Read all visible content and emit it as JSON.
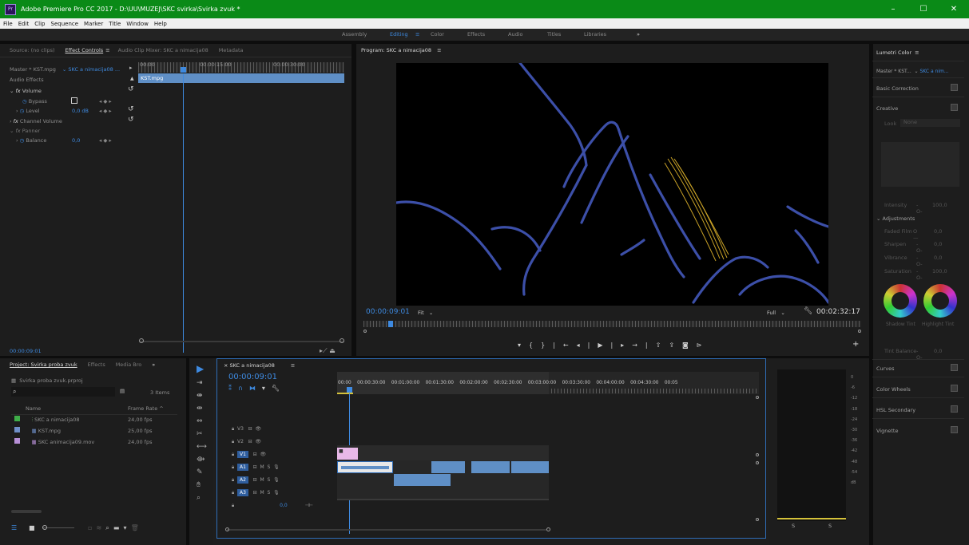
{
  "window": {
    "title": "Adobe Premiere Pro CC 2017 - D:\\UU\\MUZEJ\\SKC svirka\\Svirka zvuk *",
    "app_icon": "Pr",
    "minimize": "–",
    "maximize": "☐",
    "close": "✕"
  },
  "menu": [
    "File",
    "Edit",
    "Clip",
    "Sequence",
    "Marker",
    "Title",
    "Window",
    "Help"
  ],
  "workspaces": {
    "items": [
      "Assembly",
      "Editing",
      "Color",
      "Effects",
      "Audio",
      "Titles",
      "Libraries"
    ],
    "active": "Editing",
    "more": "»",
    "active_menu": "≡"
  },
  "source_panel": {
    "tabs": [
      "Source: (no clips)",
      "Effect Controls",
      "Audio Clip Mixer: SKC a nimacija08",
      "Metadata"
    ],
    "tab_menu": "≡",
    "master_label": "Master * KST.mpg",
    "sequence_label": "SKC a nimacija08 ...",
    "ruler_times": [
      "00:00",
      "00:00:15:00",
      "00:00:30:00"
    ],
    "clip_name": "KST.mpg",
    "audio_effects": "Audio Effects",
    "fx_volume": "Volume",
    "bypass": "Bypass",
    "level": "Level",
    "level_value": "0,0 dB",
    "fx_channel_volume": "Channel Volume",
    "panner": "Panner",
    "balance": "Balance",
    "balance_value": "0,0",
    "bottom_time": "00:00:09:01"
  },
  "program": {
    "title": "Program: SKC a nimacija08",
    "title_menu": "≡",
    "timecode": "00:00:09:01",
    "fit": "Fit",
    "full": "Full",
    "duration": "00:02:32:17"
  },
  "project": {
    "tabs": [
      "Project: Svirka proba zvuk",
      "Effects",
      "Media Bro"
    ],
    "more": "»",
    "file": "Svirka proba zvuk.prproj",
    "items_count": "3 Items",
    "col_name": "Name",
    "col_rate": "Frame Rate",
    "items": [
      {
        "name": "SKC a nimacija08",
        "rate": "24,00 fps",
        "color": "#3fae49"
      },
      {
        "name": "KST.mpg",
        "rate": "25,00 fps",
        "color": "#6f8fc8"
      },
      {
        "name": "SKC animacija09.mov",
        "rate": "24,00 fps",
        "color": "#b78fd6"
      }
    ]
  },
  "timeline": {
    "tab": "SKC a nimacija08",
    "tab_menu": "≡",
    "timecode": "00:00:09:01",
    "ruler": [
      "00:00",
      "00:00:30:00",
      "00:01:00:00",
      "00:01:30:00",
      "00:02:00:00",
      "00:02:30:00",
      "00:03:00:00",
      "00:03:30:00",
      "00:04:00:00",
      "00:04:30:00",
      "00:05"
    ],
    "video_tracks": [
      "V3",
      "V2",
      "V1"
    ],
    "audio_tracks": [
      "A1",
      "A2",
      "A3"
    ],
    "master_value": "0,0",
    "m": "M",
    "s": "S"
  },
  "meters": {
    "scale": [
      "0",
      "-6",
      "-12",
      "-18",
      "-24",
      "-30",
      "-36",
      "-42",
      "-48",
      "-54",
      "dB"
    ],
    "solo": "S"
  },
  "lumetri": {
    "title": "Lumetri Color",
    "title_menu": "≡",
    "master": "Master * KST...",
    "sequence": "SKC a nim...",
    "basic": "Basic Correction",
    "creative": "Creative",
    "look": "Look",
    "look_value": "None",
    "intensity": "Intensity",
    "intensity_value": "100,0",
    "adjustments": "Adjustments",
    "faded": "Faded Film",
    "faded_value": "0,0",
    "sharpen": "Sharpen",
    "sharpen_value": "0,0",
    "vibrance": "Vibrance",
    "vibrance_value": "0,0",
    "saturation": "Saturation",
    "saturation_value": "100,0",
    "shadow_tint": "Shadow Tint",
    "highlight_tint": "Highlight Tint",
    "tint_balance": "Tint Balance",
    "tint_balance_value": "0,0",
    "curves": "Curves",
    "color_wheels": "Color Wheels",
    "hsl": "HSL Secondary",
    "vignette": "Vignette"
  }
}
